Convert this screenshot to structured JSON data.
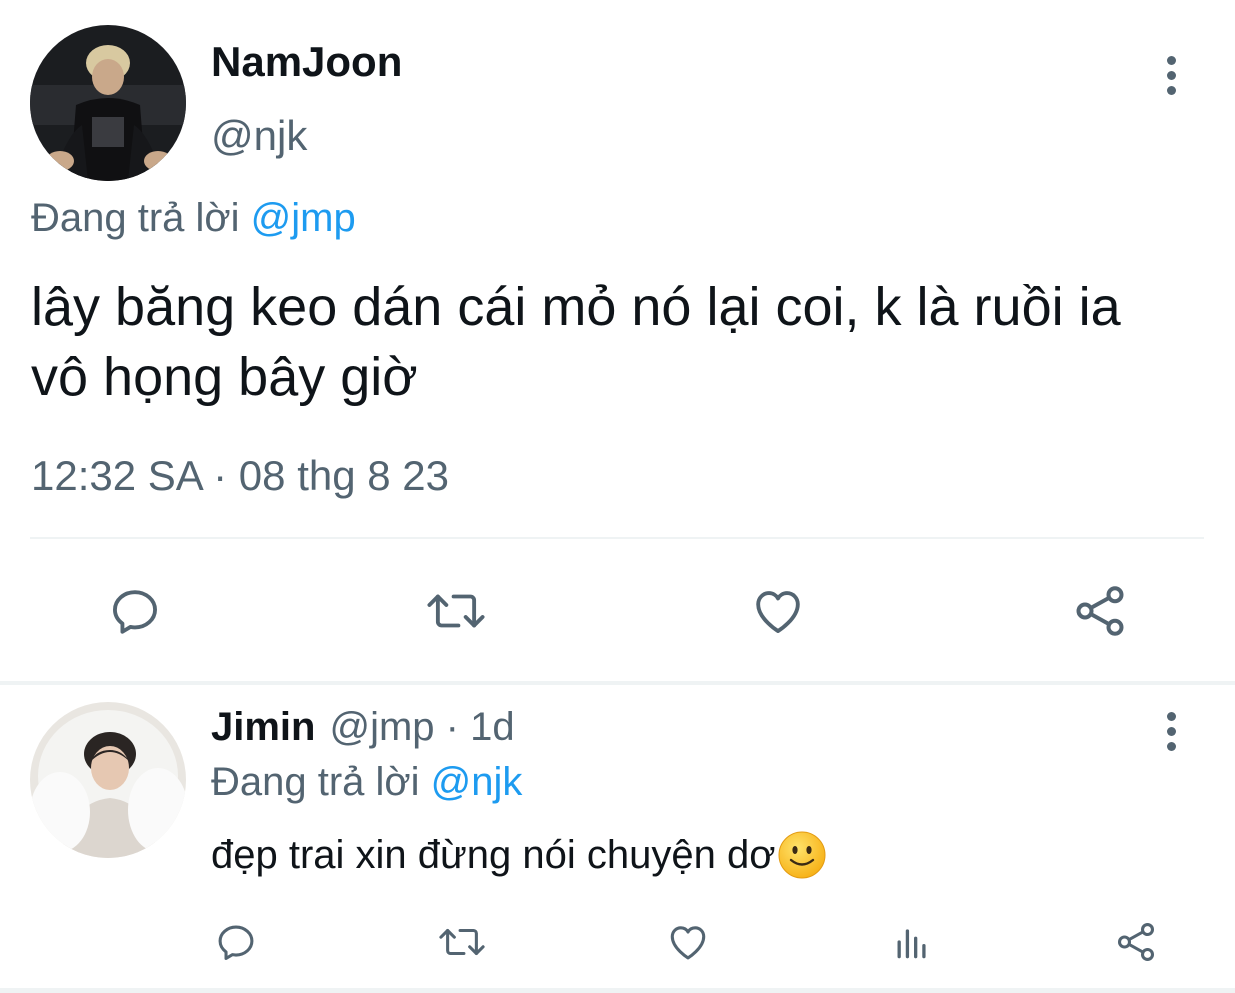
{
  "main_tweet": {
    "author": {
      "display_name": "NamJoon",
      "handle": "@njk"
    },
    "reply_context": {
      "prefix": "Đang trả lời",
      "mention": "@jmp"
    },
    "text_line1": "lây băng keo dán cái mỏ nó lại coi, k là ruồi ia",
    "text_line2": "vô họng bây giờ",
    "timestamp": "12:32 SA · 08 thg 8 23",
    "actions": [
      "reply-icon",
      "retweet-icon",
      "like-icon",
      "share-icon"
    ]
  },
  "reply_tweet": {
    "author": {
      "display_name": "Jimin",
      "handle": "@jmp",
      "separator": "·",
      "time": "1d"
    },
    "reply_context": {
      "prefix": "Đang trả lời",
      "mention": "@njk"
    },
    "text": "đẹp trai xin đừng nói chuyện dơ",
    "emoji": "slightly-smiling-face",
    "actions": [
      "reply-icon",
      "retweet-icon",
      "like-icon",
      "analytics-icon",
      "share-icon"
    ]
  },
  "colors": {
    "text_primary": "#0f1419",
    "text_secondary": "#536471",
    "accent": "#1d9bf0",
    "divider": "#eff3f4"
  }
}
